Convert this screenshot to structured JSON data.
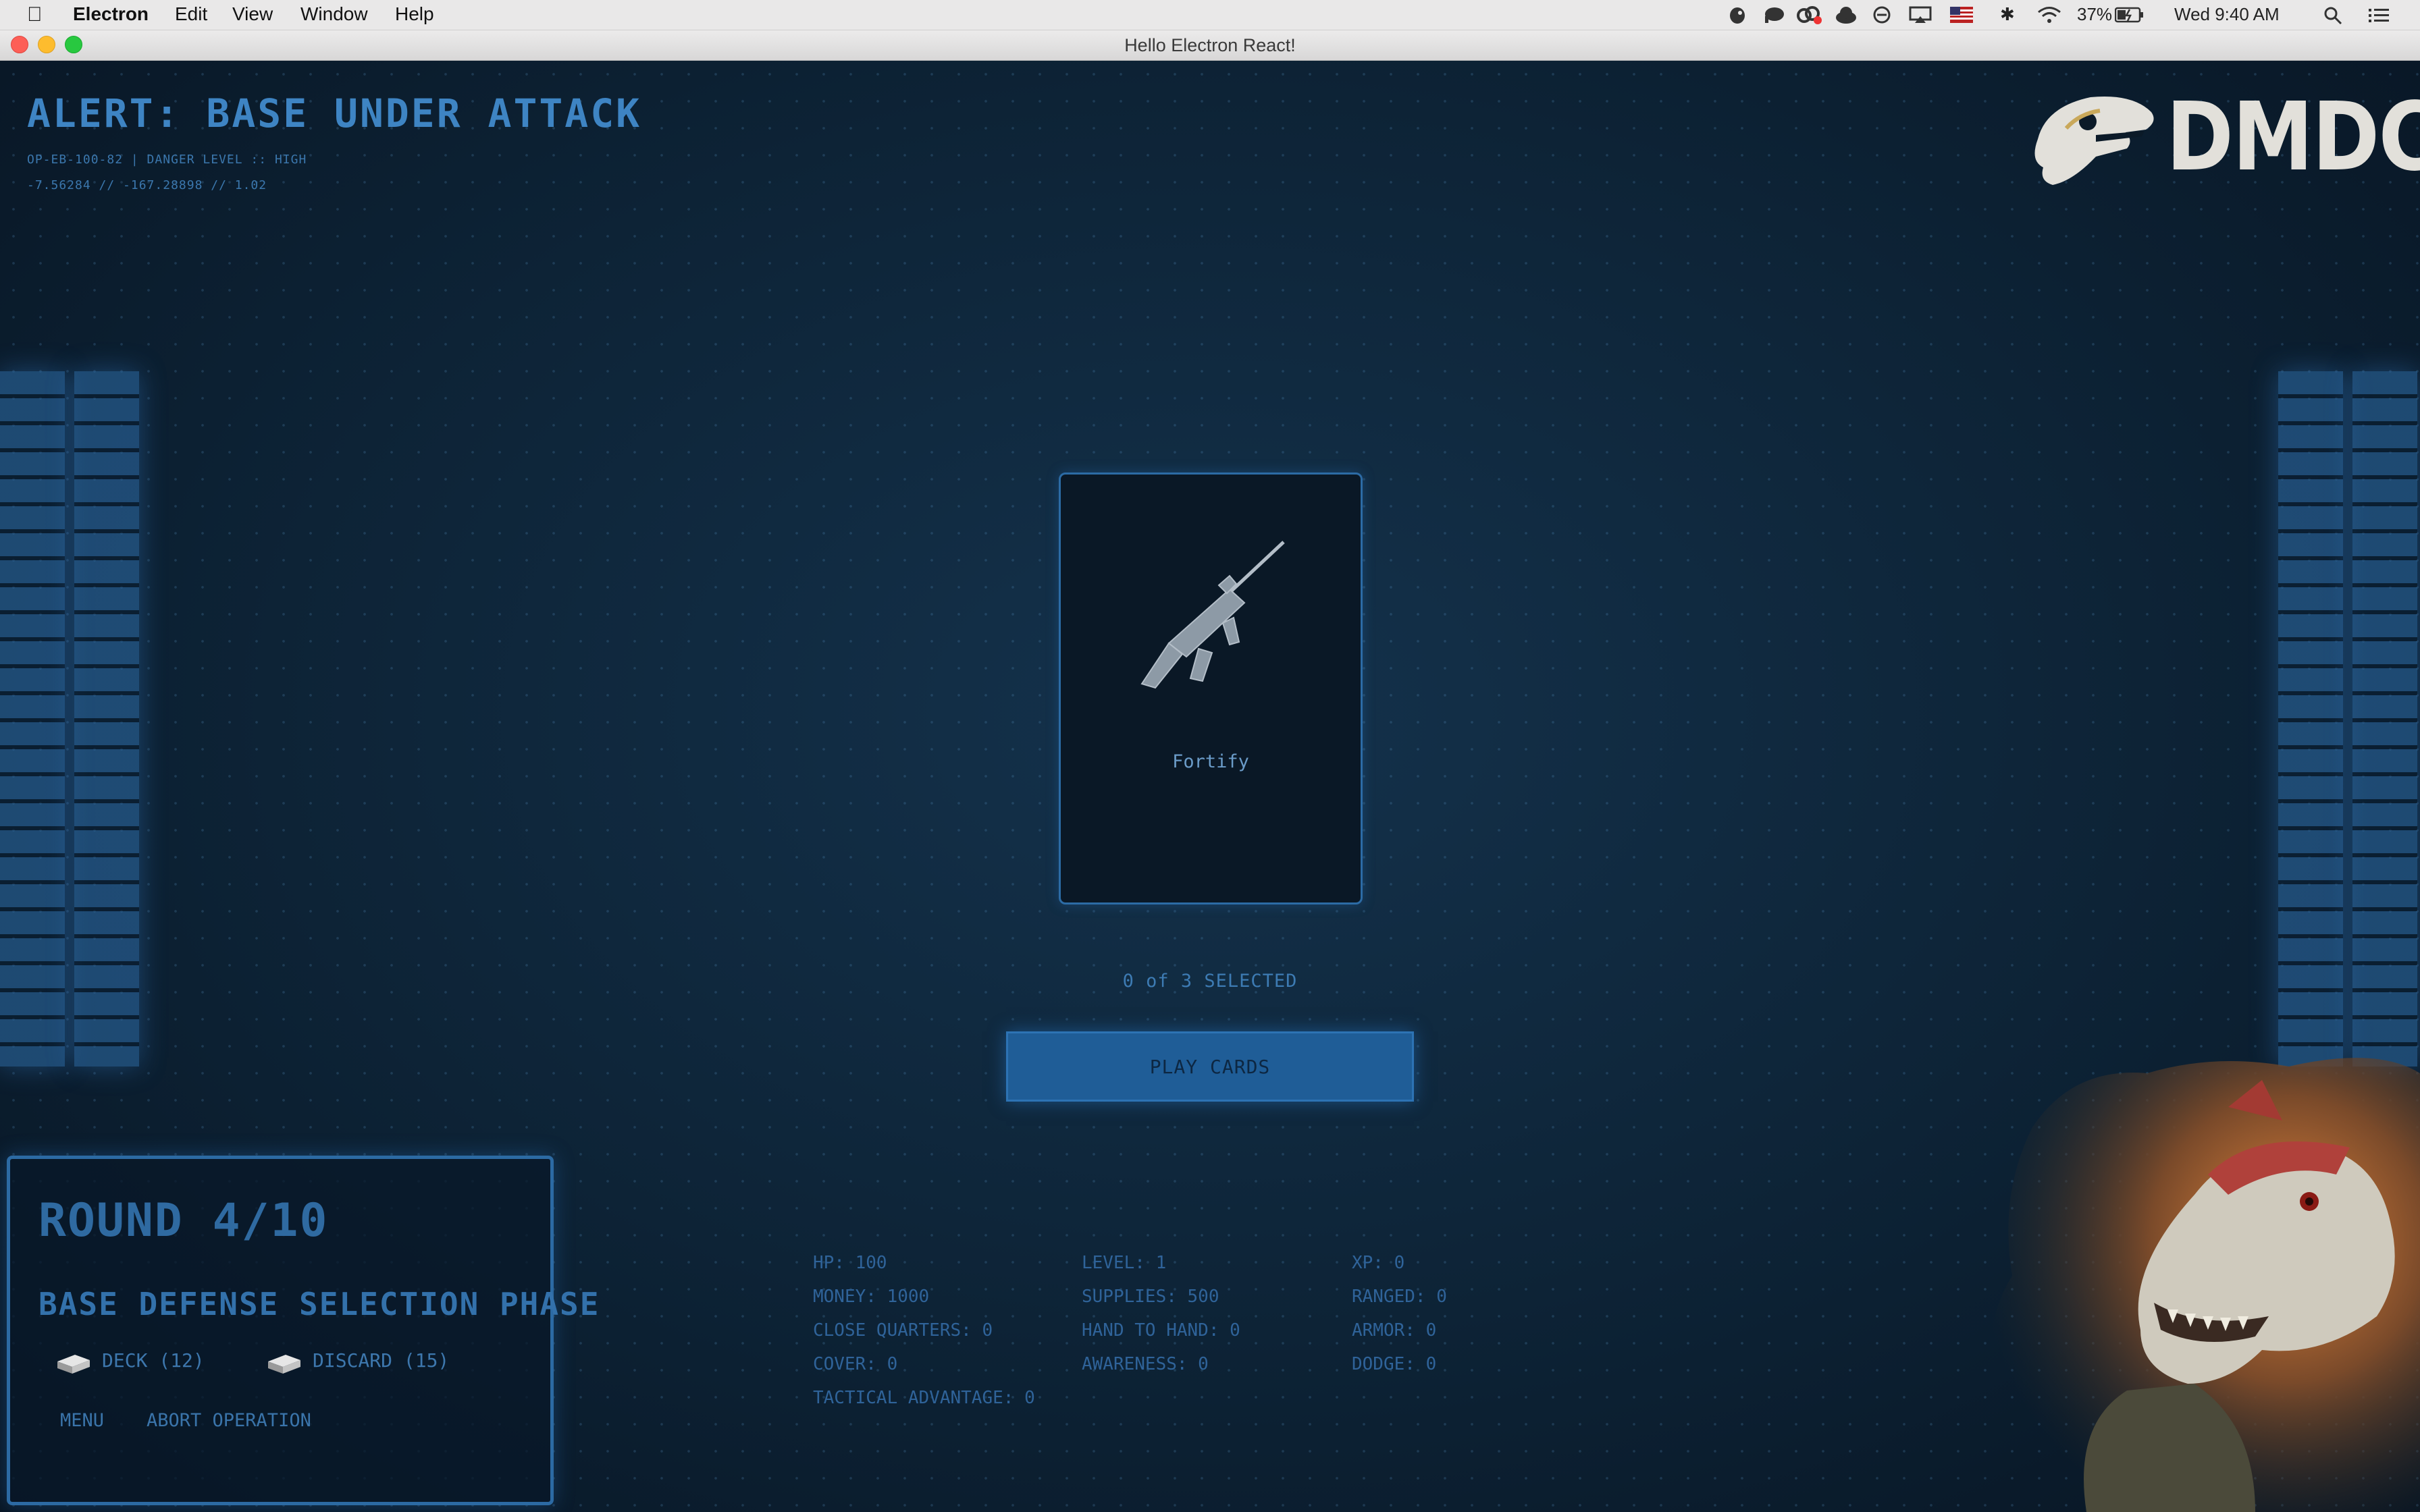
{
  "menubar": {
    "app_name": "Electron",
    "menus": [
      "Edit",
      "View",
      "Window",
      "Help"
    ],
    "battery": "37%",
    "clock": "Wed 9:40 AM"
  },
  "window": {
    "title": "Hello Electron React!"
  },
  "hud": {
    "alert_title": "ALERT: BASE UNDER ATTACK",
    "op_line": "OP-EB-100-82 | DANGER LEVEL :: HIGH",
    "coords_line": "-7.56284 // -167.28898 // 1.02",
    "logo_text": "DMDC"
  },
  "card": {
    "name": "Fortify",
    "icon": "rifle-icon"
  },
  "selection": {
    "text": "0 of 3 SELECTED",
    "selected": 0,
    "max": 3
  },
  "play_button": {
    "label": "PLAY CARDS"
  },
  "round_panel": {
    "round": "ROUND 4/10",
    "phase": "BASE DEFENSE SELECTION PHASE",
    "deck": "DECK (12)",
    "discard": "DISCARD (15)",
    "menu": "MENU",
    "abort": "ABORT OPERATION"
  },
  "stats": {
    "hp": "HP: 100",
    "level": "LEVEL: 1",
    "xp": "XP: 0",
    "money": "MONEY: 1000",
    "supplies": "SUPPLIES: 500",
    "ranged": "RANGED: 0",
    "close_quarters": "CLOSE QUARTERS: 0",
    "hand_to_hand": "HAND TO HAND: 0",
    "armor": "ARMOR: 0",
    "cover": "COVER: 0",
    "awareness": "AWARENESS: 0",
    "dodge": "DODGE: 0",
    "tactical_advantage": "TACTICAL ADVANTAGE: 0"
  },
  "colors": {
    "accent": "#2f6aa1",
    "button": "#1f5d97",
    "background": "#0d2336"
  }
}
